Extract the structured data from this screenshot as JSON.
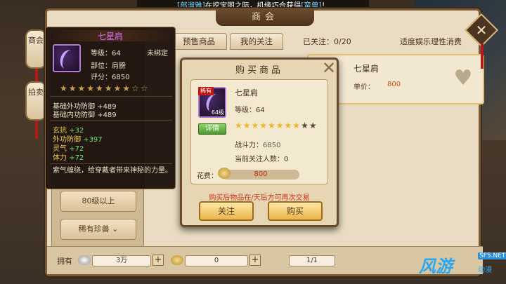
{
  "ticker": {
    "prefix": "[部溜雅]",
    "text": "在挖宝图之际，机缘巧合获得",
    "item": "[蛮兽]",
    "suffix": "！"
  },
  "shop": {
    "title": "商会",
    "vtabs": [
      "商会",
      "拍卖"
    ],
    "tabs": [
      "预售商品",
      "我的关注"
    ],
    "followed": "已关注：0/20",
    "moderate": "适度娱乐理性消费",
    "left_buttons": [
      "80级以上",
      "稀有珍兽 ⌄"
    ],
    "card": {
      "name": "七星肩",
      "price_label": "单价：",
      "price": "800"
    },
    "bottom": {
      "have_label": "拥有",
      "silver": "3万",
      "gold": "0",
      "page": "1/1"
    }
  },
  "tooltip": {
    "title": "七星肩",
    "level": "等级：64",
    "bind": "未绑定",
    "slot": "部位：肩膀",
    "score": "评分：6850",
    "stars": "★★★★★★★★☆☆",
    "base_ext_label": "基础外功防御",
    "base_ext": "+489",
    "base_int_label": "基础内功防御",
    "base_int": "+489",
    "extra": [
      {
        "label": "玄抗",
        "value": "+32"
      },
      {
        "label": "外功防御",
        "value": "+397"
      },
      {
        "label": "灵气",
        "value": "+72"
      },
      {
        "label": "体力",
        "value": "+72"
      }
    ],
    "desc": "紫气缠绕，给穿戴者带来神秘的力量。"
  },
  "dialog": {
    "title": "购买商品",
    "close": "✕",
    "item_badge": "稀有",
    "item_level": "64级",
    "detail": "详情",
    "name": "七星肩",
    "level": "等级：64",
    "stars_filled": "★★★★★★★★",
    "stars_empty": "★★",
    "power_label": "战斗力：",
    "power": "6850",
    "followers": "当前关注人数：0",
    "cost_label": "花费：",
    "cost": "800",
    "note": "购买后物品在/天后方可再次交易",
    "follow_btn": "关注",
    "buy_btn": "购买"
  },
  "watermark": {
    "big": "风游",
    "tag": "SF5.NET",
    "sub": "动漫"
  }
}
